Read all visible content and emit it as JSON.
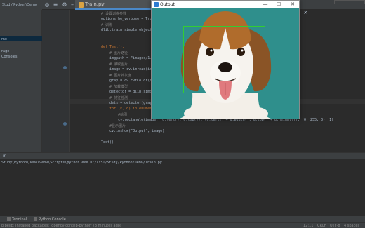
{
  "editor": {
    "file_tab": "Train.py",
    "project_header": "Study\\Python\\Demo",
    "tree_items": [
      "mo",
      "rage",
      "Consoles"
    ],
    "lines": [
      {
        "text": "# 设置训练参数",
        "style": "cmt"
      },
      {
        "text": "options.be_verbose = True",
        "style": ""
      },
      {
        "text": "# 训练",
        "style": "cmt"
      },
      {
        "text": "dlib.train_simple_object_detector(\"images/training.xml\", \"detector.svm\", options)",
        "style": ""
      },
      {
        "text": "",
        "style": ""
      },
      {
        "text": "",
        "style": ""
      },
      {
        "text": "def Test():",
        "style": "kw"
      },
      {
        "text": "    # 图片路径",
        "style": "cmt"
      },
      {
        "text": "    imgpath = \"images/1.jpg\"",
        "style": ""
      },
      {
        "text": "    # 读取图片",
        "style": "cmt"
      },
      {
        "text": "    image = cv.imread(imgpath)",
        "style": ""
      },
      {
        "text": "    # 图片转灰度",
        "style": "cmt"
      },
      {
        "text": "    gray = cv.cvtColor(image, cv.COLOR_BGR2GRAY)",
        "style": ""
      },
      {
        "text": "    # 加载模型",
        "style": "cmt"
      },
      {
        "text": "    detector = dlib.simple_object_detector(\"detector.svm\")",
        "style": ""
      },
      {
        "text": "    # 特征检测",
        "style": "cmt"
      },
      {
        "text": "    dets = detector(gray)",
        "style": ""
      },
      {
        "text": "    for (k, d) in enumerate(dets):",
        "style": "kw"
      },
      {
        "text": "        #绘图",
        "style": "cmt"
      },
      {
        "text": "        cv.rectangle(image, (d.left(), d.top()), (d.left() + d.width(), d.top() + d.height()), (0, 255, 0), 1)",
        "style": ""
      },
      {
        "text": "    #显示图片",
        "style": "cmt"
      },
      {
        "text": "    cv.imshow(\"Output\", image)",
        "style": ""
      },
      {
        "text": "",
        "style": ""
      },
      {
        "text": "Test()",
        "style": ""
      }
    ]
  },
  "run": {
    "tab_label": "in",
    "console_line": "Study\\Python\\Demo\\venv\\Scripts\\python.exe D:/XYST/Study/Python/Demo/Train.py"
  },
  "tool_tabs": [
    "Terminal",
    "Python Console"
  ],
  "status": {
    "message": "pipelib: Installed packages: 'opencv-contrib-python' (3 minutes ago)",
    "position": "12:11",
    "line_sep": "CRLF",
    "encoding": "UTF-8",
    "indent": "4 spaces"
  },
  "output_window": {
    "title": "Output",
    "minimize": "—",
    "maximize": "☐",
    "close": "✕"
  },
  "colors": {
    "ide_bg": "#2b2b2b",
    "panel_bg": "#3c3f41",
    "image_bg": "#2f8f8c",
    "detect_box": "#33cc33"
  }
}
